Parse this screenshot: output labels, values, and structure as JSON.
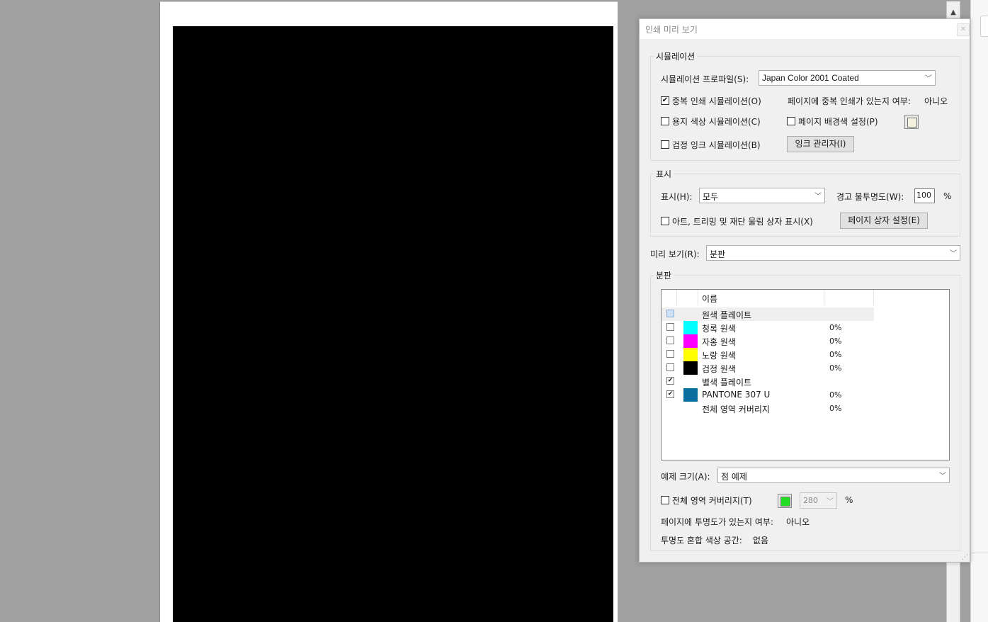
{
  "dialog": {
    "title": "인쇄 미리 보기",
    "close_icon": "close-icon"
  },
  "simulation": {
    "legend": "시뮬레이션",
    "profile_label": "시뮬레이션 프로파일(S):",
    "profile_value": "Japan Color 2001 Coated",
    "overprint_label": "중복 인쇄 시뮬레이션(O)",
    "overprint_checked": true,
    "page_has_overprint_label": "페이지에 중복 인쇄가 있는지 여부:",
    "page_has_overprint_value": "아니오",
    "paper_color_label": "용지 색상 시뮬레이션(C)",
    "paper_color_checked": false,
    "page_bg_label": "페이지 배경색 설정(P)",
    "page_bg_checked": false,
    "page_bg_color": "#f4f1de",
    "black_ink_label": "검정 잉크 시뮬레이션(B)",
    "black_ink_checked": false,
    "ink_manager_label": "잉크 관리자(I)"
  },
  "display": {
    "legend": "표시",
    "show_label": "표시(H):",
    "show_value": "모두",
    "warning_opacity_label": "경고 불투명도(W):",
    "warning_opacity_value": "100",
    "percent": "%",
    "art_trim_label": "아트, 트리밍 및 재단 물림 상자 표시(X)",
    "art_trim_checked": false,
    "page_box_label": "페이지 상자 설정(E)"
  },
  "preview": {
    "label": "미리 보기(R):",
    "value": "분판"
  },
  "separations": {
    "legend": "분판",
    "column_name": "이름",
    "rows": [
      {
        "name": "원색 플레이트",
        "color": "",
        "checked": false,
        "percent": "",
        "selected": true
      },
      {
        "name": "청록 원색",
        "color": "#00ffff",
        "checked": false,
        "percent": "0%"
      },
      {
        "name": "자홍 원색",
        "color": "#ff00ff",
        "checked": false,
        "percent": "0%"
      },
      {
        "name": "노랑 원색",
        "color": "#ffff00",
        "checked": false,
        "percent": "0%"
      },
      {
        "name": "검정 원색",
        "color": "#000000",
        "checked": false,
        "percent": "0%"
      },
      {
        "name": "별색 플레이트",
        "color": "",
        "checked": true,
        "percent": ""
      },
      {
        "name": "PANTONE 307 U",
        "color": "#0a6e9e",
        "checked": true,
        "percent": "0%"
      },
      {
        "name": "전체 영역 커버리지",
        "color": "",
        "checked": null,
        "percent": "0%"
      }
    ]
  },
  "sample": {
    "label": "예제 크기(A):",
    "value": "점 예제"
  },
  "coverage": {
    "label": "전체 영역 커버리지(T)",
    "checked": false,
    "swatch_color": "#22dd22",
    "value": "280",
    "percent": "%"
  },
  "transparency": {
    "has_label": "페이지에 투명도가 있는지 여부:",
    "has_value": "아니오",
    "blend_label": "투명도 혼합 색상 공간:",
    "blend_value": "없음"
  },
  "colors": {
    "document_bg": "#a0a0a0",
    "page": "#ffffff",
    "art": "#000000",
    "dialog_bg": "#f0f0f0"
  }
}
